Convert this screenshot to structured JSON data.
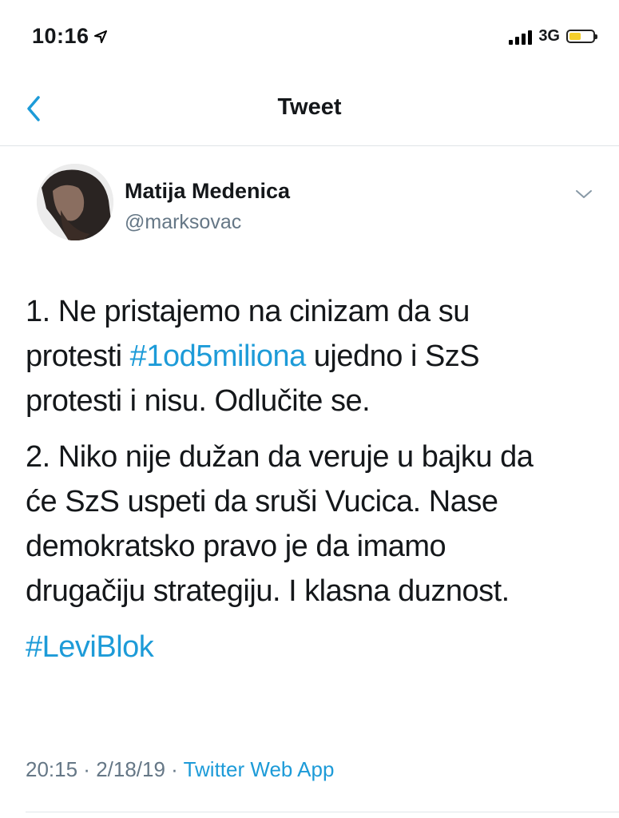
{
  "status_bar": {
    "time": "10:16",
    "network": "3G",
    "icons": [
      "location-arrow-icon",
      "signal-icon",
      "battery-icon"
    ],
    "battery_color": "#f5cf2b"
  },
  "nav": {
    "title": "Tweet",
    "back_icon": "chevron-left-icon",
    "accent": "#1d9bd8"
  },
  "tweet": {
    "author": {
      "display_name": "Matija Medenica",
      "handle": "@marksovac"
    },
    "paragraph1": {
      "line1": "1. Ne pristajemo na cinizam da su",
      "line2_pre": "protesti ",
      "line2_link": "#1od5miliona",
      "line2_post": " ujedno i SzS",
      "line3": "protesti i nisu. Odlučite se."
    },
    "paragraph2": {
      "line1": "2. Niko nije dužan da veruje u bajku da",
      "line2": "će SzS uspeti da sruši Vucica. Nase",
      "line3": "demokratsko pravo je da imamo",
      "line4": "drugačiju strategiju. I klasna duznost."
    },
    "hashtag": "#LeviBlok",
    "meta": {
      "time": "20:15",
      "separator1": " · ",
      "date": "2/18/19",
      "separator2": " · ",
      "source": "Twitter Web App"
    }
  }
}
